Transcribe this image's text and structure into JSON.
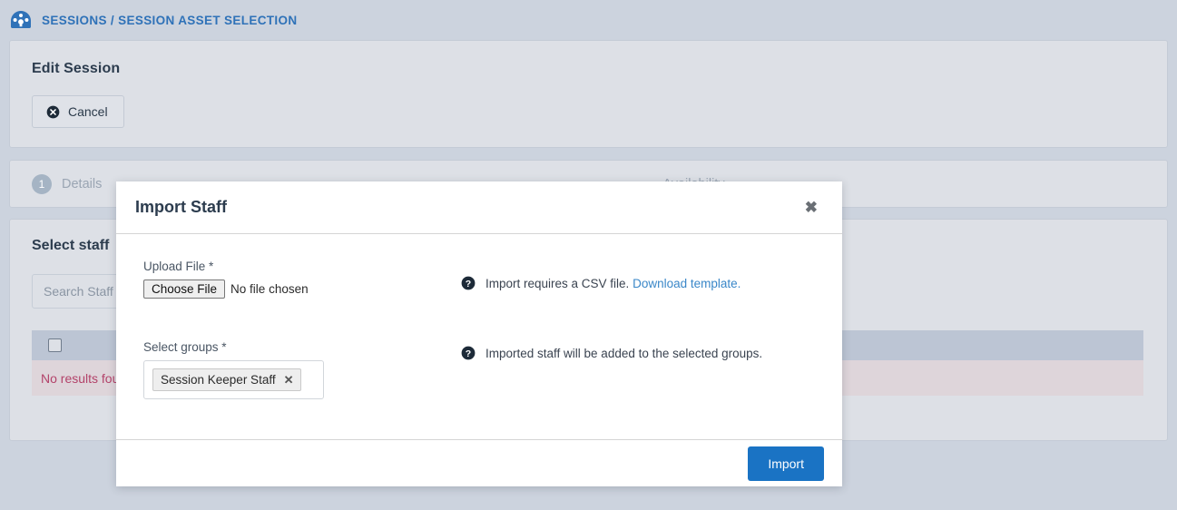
{
  "breadcrumb": {
    "icon": "dashboard-gauge-icon",
    "text": "SESSIONS / SESSION ASSET SELECTION",
    "color": "#2f72b8"
  },
  "edit_panel": {
    "title": "Edit Session",
    "cancel_label": "Cancel",
    "cancel_icon": "cancel-circle-x-icon"
  },
  "wizard_tabs": [
    {
      "number": "1",
      "label": "Details"
    },
    {
      "number": "",
      "label": "Availability"
    }
  ],
  "staff_panel": {
    "title": "Select staff",
    "search_placeholder": "Search Staff",
    "search_value": "",
    "select_all_checkbox": false,
    "empty_message": "No results found",
    "empty_message_color": "#b3436a"
  },
  "modal": {
    "title": "Import Staff",
    "close_label": "✖",
    "upload": {
      "label": "Upload File *",
      "choose_button": "Choose File",
      "file_status": "No file chosen",
      "hint_icon": "help-question-circle-icon",
      "hint_text": "Import requires a CSV file.",
      "hint_link": "Download template."
    },
    "groups": {
      "label": "Select groups *",
      "tokens": [
        {
          "label": "Session Keeper Staff",
          "remove_icon": "✕"
        }
      ],
      "hint_icon": "help-question-circle-icon",
      "hint_text": "Imported staff will be added to the selected groups."
    },
    "footer": {
      "import_label": "Import",
      "import_color": "#1a73c4"
    }
  }
}
